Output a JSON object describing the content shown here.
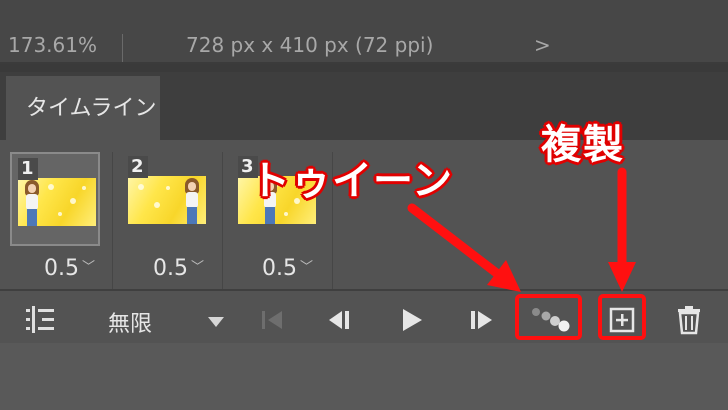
{
  "status_bar": {
    "zoom": "173.61%",
    "document_info": "728 px x 410 px (72 ppi)",
    "arrow": ">"
  },
  "panel": {
    "tab_label": "タイムライン"
  },
  "frames": [
    {
      "number": "1",
      "delay": "0.5",
      "selected": true
    },
    {
      "number": "2",
      "delay": "0.5",
      "selected": false
    },
    {
      "number": "3",
      "delay": "0.5",
      "selected": false
    }
  ],
  "toolbar": {
    "loop_option": "無限",
    "icons": [
      "convert-to-timeline-icon",
      "loop-dropdown-icon",
      "first-frame-icon",
      "previous-frame-icon",
      "play-icon",
      "next-frame-icon",
      "tween-icon",
      "duplicate-frame-icon",
      "delete-frame-icon"
    ]
  },
  "annotations": {
    "tween_label": "トゥイーン",
    "duplicate_label": "複製",
    "color": "#ff1010"
  },
  "colors": {
    "panel_bg": "#535353",
    "header_bg": "#3e3e3e",
    "selected_frame_bg": "#656565",
    "highlight_red": "#ff1010"
  }
}
